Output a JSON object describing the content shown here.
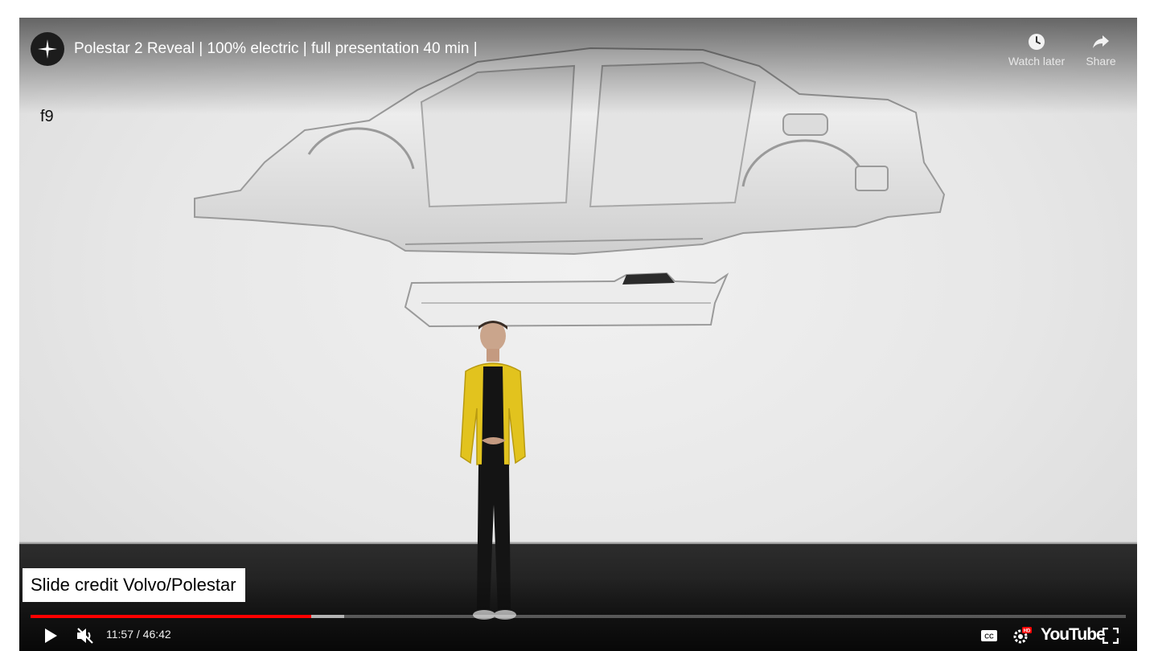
{
  "player": {
    "title": "Polestar 2 Reveal | 100% electric | full presentation 40 min |",
    "channel_icon": "polestar-star-icon",
    "actions": [
      {
        "label": "Watch later",
        "icon": "clock-icon"
      },
      {
        "label": "Share",
        "icon": "share-arrow-icon"
      }
    ],
    "overlay_label": "f9",
    "credit": "Slide credit Volvo/Polestar",
    "time_display": "11:57 / 46:42",
    "progress": {
      "played_fraction": 0.2565,
      "buffered_fraction": 0.2865
    },
    "brand": "YouTube",
    "colors": {
      "progress_played": "#ff0000",
      "jacket": "#e2c31e",
      "background": "#e6e6e6"
    }
  },
  "controls": {
    "play_icon": "play-icon",
    "mute_icon": "muted-speaker-icon",
    "captions_icon": "captions-icon",
    "settings_icon": "settings-gear-hd-icon",
    "fullscreen_icon": "fullscreen-icon"
  }
}
